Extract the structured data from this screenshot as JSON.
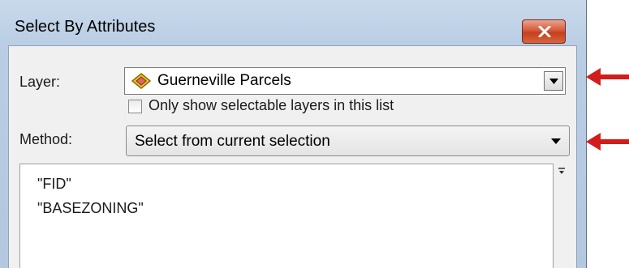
{
  "window": {
    "title": "Select By Attributes"
  },
  "layer": {
    "label": "Layer:",
    "value": "Guerneville Parcels",
    "icon": "layer-diamond-icon"
  },
  "only_selectable": {
    "label": "Only show selectable layers in this list",
    "checked": false
  },
  "method": {
    "label": "Method:",
    "value": "Select from current selection"
  },
  "fields": [
    "\"FID\"",
    "\"BASEZONING\""
  ],
  "colors": {
    "arrow": "#d21d1d",
    "title_bar": "#b9cde3",
    "close_button": "#d0502f"
  }
}
